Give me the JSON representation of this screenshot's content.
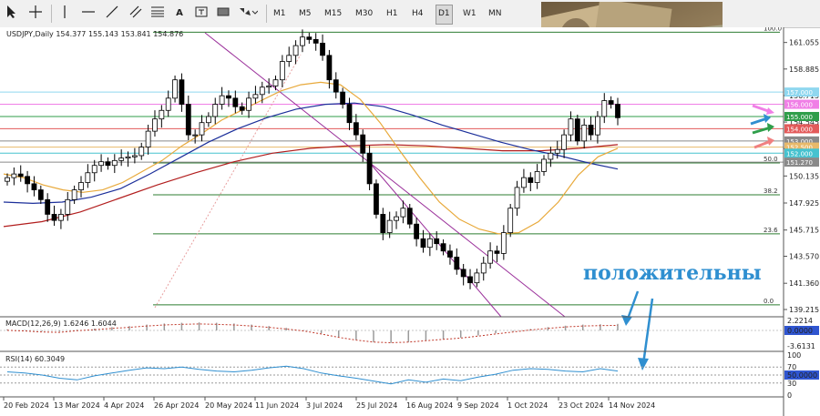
{
  "toolbar": {
    "timeframes": [
      "M1",
      "M5",
      "M15",
      "M30",
      "H1",
      "H4",
      "D1",
      "W1",
      "MN"
    ],
    "active_timeframe": "D1",
    "text_tool": "A"
  },
  "chart_data": {
    "type": "candlestick",
    "title": "USDJPY,Daily 154.377 155.143 153.841 154.876",
    "ylim": [
      139.215,
      162.5
    ],
    "y_ticks": [
      161.055,
      158.885,
      156.715,
      154.545,
      152.375,
      150.135,
      147.925,
      145.715,
      143.57,
      141.36,
      139.215
    ],
    "x_ticks": [
      "20 Feb 2024",
      "13 Mar 2024",
      "4 Apr 2024",
      "26 Apr 2024",
      "20 May 2024",
      "11 Jun 2024",
      "3 Jul 2024",
      "25 Jul 2024",
      "16 Aug 2024",
      "9 Sep 2024",
      "1 Oct 2024",
      "23 Oct 2024",
      "14 Nov 2024"
    ],
    "close_path": [
      150.0,
      150.3,
      150.1,
      149.5,
      149.0,
      148.2,
      147.0,
      146.5,
      147.0,
      148.2,
      149.0,
      149.6,
      150.4,
      151.0,
      151.3,
      151.0,
      151.4,
      151.6,
      151.7,
      151.8,
      152.5,
      153.8,
      154.8,
      155.5,
      156.5,
      158.0,
      156.0,
      153.5,
      153.5,
      154.5,
      155.0,
      156.0,
      156.7,
      156.5,
      155.8,
      155.5,
      156.5,
      156.8,
      157.4,
      157.5,
      158.0,
      159.5,
      160.0,
      160.8,
      161.5,
      161.3,
      161.0,
      160.0,
      158.0,
      157.0,
      156.0,
      154.5,
      153.5,
      152.0,
      149.5,
      147.0,
      145.5,
      146.5,
      146.8,
      147.5,
      146.2,
      145.0,
      144.3,
      145.0,
      144.6,
      144.0,
      143.5,
      142.5,
      141.9,
      141.4,
      142.2,
      143.0,
      144.0,
      143.8,
      145.5,
      147.5,
      149.2,
      150.0,
      149.6,
      150.5,
      151.5,
      152.0,
      152.3,
      153.5,
      154.8,
      153.0,
      154.3,
      153.5,
      155.0,
      156.3,
      156.0,
      154.9
    ],
    "ma_fast": [
      150.3,
      150.0,
      149.4,
      149.0,
      148.8,
      149.0,
      149.6,
      150.5,
      151.4,
      152.6,
      153.6,
      154.7,
      155.5,
      156.3,
      157.1,
      157.6,
      157.8,
      157.6,
      156.4,
      154.5,
      152.2,
      150.0,
      148.0,
      146.6,
      145.8,
      145.4,
      145.5,
      146.4,
      148.0,
      150.2,
      151.7,
      152.4
    ],
    "ma_mid": [
      148.0,
      147.9,
      148.0,
      148.4,
      149.1,
      150.3,
      151.6,
      152.9,
      154.0,
      154.9,
      155.6,
      156.0,
      156.1,
      155.8,
      155.1,
      154.3,
      153.6,
      152.9,
      152.3,
      151.8,
      151.2,
      150.7
    ],
    "ma_slow": [
      146.0,
      146.4,
      147.2,
      148.3,
      149.4,
      150.4,
      151.3,
      152.0,
      152.4,
      152.6,
      152.7,
      152.6,
      152.4,
      152.2,
      152.2,
      152.4,
      152.7
    ],
    "fibonacci": {
      "levels": [
        {
          "label": "100.0",
          "price": 161.9
        },
        {
          "label": "50.0",
          "price": 151.2
        },
        {
          "label": "38.2",
          "price": 148.6
        },
        {
          "label": "23.6",
          "price": 145.4
        },
        {
          "label": "0.0",
          "price": 139.6
        }
      ]
    },
    "price_labels": [
      {
        "text": "157.000",
        "price": 157.0,
        "color": "#8fd7ef"
      },
      {
        "text": "156.000",
        "price": 156.0,
        "color": "#f07fe6"
      },
      {
        "text": "155.000",
        "price": 155.0,
        "color": "#2f9e4a"
      },
      {
        "text": "154.000",
        "price": 154.0,
        "color": "#e35a5a"
      },
      {
        "text": "153.000",
        "price": 153.0,
        "color": "#8a8a8a"
      },
      {
        "text": "152.500",
        "price": 152.5,
        "color": "#e8b96a"
      },
      {
        "text": "152.000",
        "price": 152.0,
        "color": "#46c2cf"
      },
      {
        "text": "151.270",
        "price": 151.27,
        "color": "#8a8a8a"
      }
    ],
    "macd": {
      "label": "MACD(12,26,9) 1.6246 1.6044",
      "ticks": [
        "2.2214",
        "0.0000",
        "-3.6131"
      ],
      "hist": [
        0.3,
        0.1,
        -0.2,
        -0.3,
        0.2,
        0.5,
        0.9,
        1.2,
        1.6,
        1.9,
        2.1,
        2.2,
        2.1,
        1.9,
        1.6,
        1.2,
        0.7,
        0.1,
        -0.8,
        -1.8,
        -2.6,
        -3.2,
        -3.4,
        -3.2,
        -2.8,
        -2.4,
        -2.0,
        -1.4,
        -0.8,
        -0.2,
        0.4,
        0.9,
        1.3,
        1.6,
        1.7,
        1.8
      ]
    },
    "rsi": {
      "label": "RSI(14) 60.3049",
      "ticks": [
        "100",
        "70",
        "50",
        "30",
        "0"
      ],
      "values": [
        58,
        55,
        50,
        42,
        38,
        48,
        55,
        62,
        68,
        66,
        70,
        64,
        60,
        58,
        62,
        68,
        72,
        66,
        55,
        48,
        42,
        35,
        28,
        38,
        32,
        40,
        36,
        45,
        52,
        62,
        66,
        64,
        60,
        58,
        66,
        60
      ]
    },
    "annotation_text": "положительны"
  },
  "colors": {
    "bull_candle": "#ffffff",
    "bear_candle": "#000000",
    "ma_fast": "#e8a93a",
    "ma_mid": "#1c2f9a",
    "ma_slow": "#b21e1e",
    "fib": "#2e7d32",
    "channel": "#9a2f9a",
    "arrow_blue": "#2f8fd0"
  }
}
